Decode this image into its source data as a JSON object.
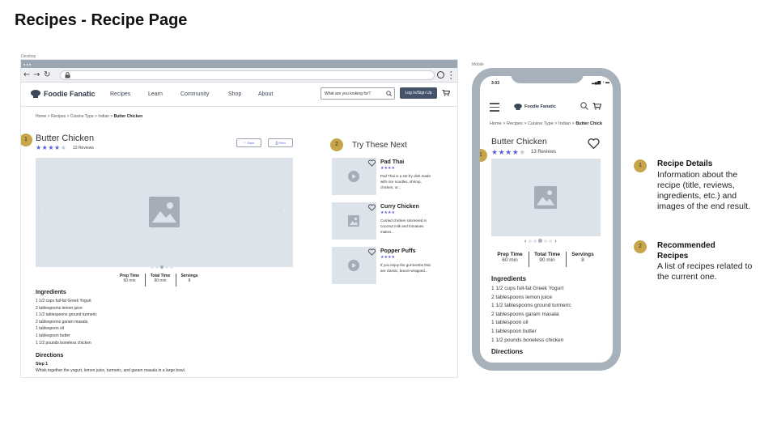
{
  "page_title": "Recipes - Recipe Page",
  "desktop": {
    "caption": "Desktop",
    "brand": "Foodie Fanatic",
    "nav": [
      "Recipes",
      "Learn",
      "Community",
      "Shop",
      "About"
    ],
    "search_placeholder": "What are you looking for?",
    "login_label": "Log In/Sign Up",
    "breadcrumb": {
      "path": "Home > Recipes > Cuisine Type > Indian >",
      "current": "Butter Chicken"
    },
    "badge_1": "1",
    "badge_2": "2",
    "recipe": {
      "title": "Butter Chicken",
      "stars": "★★★★",
      "star_empty": "★",
      "rating": 4,
      "reviews": "13 Reviews",
      "save_label": "♡ Save",
      "print_label": "⎙ Print",
      "stats": [
        {
          "label": "Prep Time",
          "value": "60 min"
        },
        {
          "label": "Total Time",
          "value": "90 min"
        },
        {
          "label": "Servings",
          "value": "8"
        }
      ],
      "ingredients_heading": "Ingredients",
      "ingredients": [
        "1 1/2 cups full-fat Greek Yogurt",
        "2 tablespoons lemon juice",
        "1 1/2 tablespoons ground turmeric",
        "2 tablespoons garam masala",
        "1 tablespoon oil",
        "1 tablespoon butter",
        "1 1/2 pounds boneless chicken"
      ],
      "directions_heading": "Directions",
      "step_label": "Step 1",
      "step_text": "Whisk together the yogurt, lemon juice, turmeric, and garam masala in a large bowl."
    },
    "try_heading": "Try These Next",
    "cards": [
      {
        "name": "Pad Thai",
        "stars": "★★★★",
        "desc": "Pad Thai is a stir-fry dish made with rice noodles, shrimp, chicken, or...",
        "media": "video"
      },
      {
        "name": "Curry Chicken",
        "stars": "★★★★",
        "desc": "Curried chicken simmered in coconut milk and tomatoes makes...",
        "media": "image"
      },
      {
        "name": "Popper Puffs",
        "stars": "★★★★",
        "desc": "If you enjoy the gut-bombs that are classic, bacon-wrapped...",
        "media": "video"
      }
    ]
  },
  "mobile": {
    "caption": "Mobile",
    "time": "3:03",
    "brand": "Foodie Fanatic",
    "breadcrumb": {
      "path": "Home > Recipes > Cuisine Type > Indian >",
      "current": "Butter Chick"
    },
    "title": "Butter Chicken",
    "stars": "★★★★",
    "star_empty": "★",
    "reviews": "13 Reviews",
    "stats": [
      {
        "label": "Prep Time",
        "value": "60 min"
      },
      {
        "label": "Total Time",
        "value": "90 min"
      },
      {
        "label": "Servings",
        "value": "8"
      }
    ],
    "ingredients_heading": "Ingredients",
    "ingredients": [
      "1 1/2 cups full-fat Greek Yogurt",
      "2 tablespoons lemon juice",
      "1 1/2 tablespoons ground turmeric",
      "2 tablespoons garam masala",
      "1 tablespoon oil",
      "1 tablespoon butter",
      "1 1/2 pounds boneless chicken"
    ],
    "directions_heading": "Directions"
  },
  "legend": [
    {
      "num": "1",
      "heading": "Recipe Details",
      "text": "Information about the recipe (title, reviews, ingredients, etc.) and images of the end result."
    },
    {
      "num": "2",
      "heading": "Recommended Recipes",
      "text": "A list of recipes related to the current one."
    }
  ],
  "colors": {
    "accent": "#5b62d6",
    "badge": "#c9a54a",
    "frame": "#a7b1bc",
    "placeholder": "#dde3ea",
    "button": "#44536a"
  }
}
